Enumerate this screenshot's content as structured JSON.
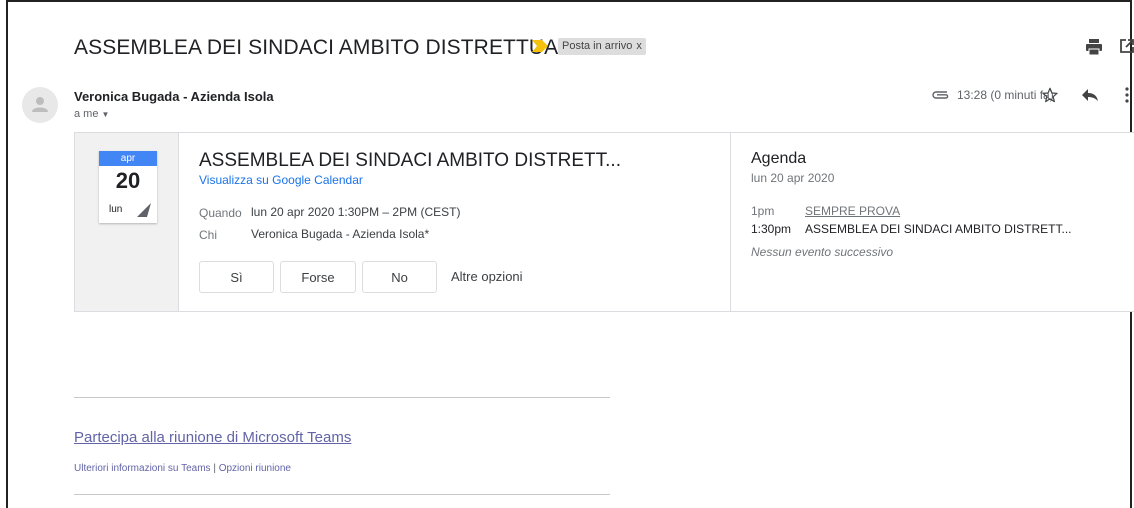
{
  "email": {
    "subject": "ASSEMBLEA DEI SINDACI AMBITO DISTRETTUALE",
    "label": "Posta in arrivo",
    "label_close": "x",
    "sender": "Veronica Bugada - Azienda Isola",
    "recipient": "a me",
    "time": "13:28 (0 minuti fa)"
  },
  "icons": {
    "importance": "importance-marker-icon",
    "print": "print-icon",
    "new_window": "open-in-new-window-icon",
    "attachment": "attachment-icon",
    "star": "star-icon",
    "reply": "reply-icon",
    "more": "more-vertical-icon",
    "avatar": "avatar-placeholder-icon"
  },
  "invite": {
    "calendar_month": "apr",
    "calendar_day": "20",
    "calendar_weekday": "lun",
    "title": "ASSEMBLEA DEI SINDACI AMBITO DISTRETT...",
    "view_link": "Visualizza su Google Calendar",
    "when_label": "Quando",
    "when_value": "lun 20 apr 2020 1:30PM – 2PM (CEST)",
    "who_label": "Chi",
    "who_value": "Veronica Bugada - Azienda Isola*",
    "rsvp": {
      "yes": "Sì",
      "maybe": "Forse",
      "no": "No",
      "more": "Altre opzioni"
    }
  },
  "agenda": {
    "title": "Agenda",
    "date": "lun 20 apr 2020",
    "events": [
      {
        "time": "1pm",
        "title": "SEMPRE PROVA"
      },
      {
        "time": "1:30pm",
        "title": "ASSEMBLEA DEI SINDACI AMBITO DISTRETT..."
      }
    ],
    "no_next": "Nessun evento successivo"
  },
  "teams": {
    "join_link": "Partecipa alla riunione di Microsoft Teams",
    "more_info": "Ulteriori informazioni su Teams",
    "separator": "|",
    "options": "Opzioni riunione"
  },
  "colors": {
    "accent_blue": "#4285f4",
    "link_blue": "#1a73e8",
    "teams_purple": "#6264a7",
    "label_yellow": "#f4c20d"
  }
}
